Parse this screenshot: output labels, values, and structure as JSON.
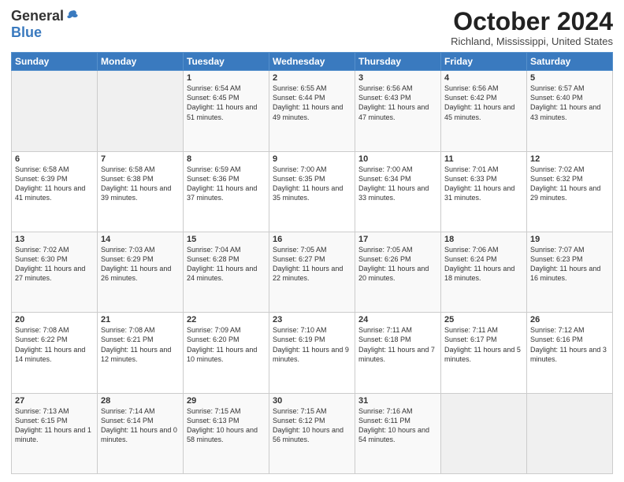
{
  "logo": {
    "general": "General",
    "blue": "Blue"
  },
  "title": "October 2024",
  "location": "Richland, Mississippi, United States",
  "days_header": [
    "Sunday",
    "Monday",
    "Tuesday",
    "Wednesday",
    "Thursday",
    "Friday",
    "Saturday"
  ],
  "weeks": [
    [
      {
        "day": "",
        "info": ""
      },
      {
        "day": "",
        "info": ""
      },
      {
        "day": "1",
        "info": "Sunrise: 6:54 AM\nSunset: 6:45 PM\nDaylight: 11 hours and 51 minutes."
      },
      {
        "day": "2",
        "info": "Sunrise: 6:55 AM\nSunset: 6:44 PM\nDaylight: 11 hours and 49 minutes."
      },
      {
        "day": "3",
        "info": "Sunrise: 6:56 AM\nSunset: 6:43 PM\nDaylight: 11 hours and 47 minutes."
      },
      {
        "day": "4",
        "info": "Sunrise: 6:56 AM\nSunset: 6:42 PM\nDaylight: 11 hours and 45 minutes."
      },
      {
        "day": "5",
        "info": "Sunrise: 6:57 AM\nSunset: 6:40 PM\nDaylight: 11 hours and 43 minutes."
      }
    ],
    [
      {
        "day": "6",
        "info": "Sunrise: 6:58 AM\nSunset: 6:39 PM\nDaylight: 11 hours and 41 minutes."
      },
      {
        "day": "7",
        "info": "Sunrise: 6:58 AM\nSunset: 6:38 PM\nDaylight: 11 hours and 39 minutes."
      },
      {
        "day": "8",
        "info": "Sunrise: 6:59 AM\nSunset: 6:36 PM\nDaylight: 11 hours and 37 minutes."
      },
      {
        "day": "9",
        "info": "Sunrise: 7:00 AM\nSunset: 6:35 PM\nDaylight: 11 hours and 35 minutes."
      },
      {
        "day": "10",
        "info": "Sunrise: 7:00 AM\nSunset: 6:34 PM\nDaylight: 11 hours and 33 minutes."
      },
      {
        "day": "11",
        "info": "Sunrise: 7:01 AM\nSunset: 6:33 PM\nDaylight: 11 hours and 31 minutes."
      },
      {
        "day": "12",
        "info": "Sunrise: 7:02 AM\nSunset: 6:32 PM\nDaylight: 11 hours and 29 minutes."
      }
    ],
    [
      {
        "day": "13",
        "info": "Sunrise: 7:02 AM\nSunset: 6:30 PM\nDaylight: 11 hours and 27 minutes."
      },
      {
        "day": "14",
        "info": "Sunrise: 7:03 AM\nSunset: 6:29 PM\nDaylight: 11 hours and 26 minutes."
      },
      {
        "day": "15",
        "info": "Sunrise: 7:04 AM\nSunset: 6:28 PM\nDaylight: 11 hours and 24 minutes."
      },
      {
        "day": "16",
        "info": "Sunrise: 7:05 AM\nSunset: 6:27 PM\nDaylight: 11 hours and 22 minutes."
      },
      {
        "day": "17",
        "info": "Sunrise: 7:05 AM\nSunset: 6:26 PM\nDaylight: 11 hours and 20 minutes."
      },
      {
        "day": "18",
        "info": "Sunrise: 7:06 AM\nSunset: 6:24 PM\nDaylight: 11 hours and 18 minutes."
      },
      {
        "day": "19",
        "info": "Sunrise: 7:07 AM\nSunset: 6:23 PM\nDaylight: 11 hours and 16 minutes."
      }
    ],
    [
      {
        "day": "20",
        "info": "Sunrise: 7:08 AM\nSunset: 6:22 PM\nDaylight: 11 hours and 14 minutes."
      },
      {
        "day": "21",
        "info": "Sunrise: 7:08 AM\nSunset: 6:21 PM\nDaylight: 11 hours and 12 minutes."
      },
      {
        "day": "22",
        "info": "Sunrise: 7:09 AM\nSunset: 6:20 PM\nDaylight: 11 hours and 10 minutes."
      },
      {
        "day": "23",
        "info": "Sunrise: 7:10 AM\nSunset: 6:19 PM\nDaylight: 11 hours and 9 minutes."
      },
      {
        "day": "24",
        "info": "Sunrise: 7:11 AM\nSunset: 6:18 PM\nDaylight: 11 hours and 7 minutes."
      },
      {
        "day": "25",
        "info": "Sunrise: 7:11 AM\nSunset: 6:17 PM\nDaylight: 11 hours and 5 minutes."
      },
      {
        "day": "26",
        "info": "Sunrise: 7:12 AM\nSunset: 6:16 PM\nDaylight: 11 hours and 3 minutes."
      }
    ],
    [
      {
        "day": "27",
        "info": "Sunrise: 7:13 AM\nSunset: 6:15 PM\nDaylight: 11 hours and 1 minute."
      },
      {
        "day": "28",
        "info": "Sunrise: 7:14 AM\nSunset: 6:14 PM\nDaylight: 11 hours and 0 minutes."
      },
      {
        "day": "29",
        "info": "Sunrise: 7:15 AM\nSunset: 6:13 PM\nDaylight: 10 hours and 58 minutes."
      },
      {
        "day": "30",
        "info": "Sunrise: 7:15 AM\nSunset: 6:12 PM\nDaylight: 10 hours and 56 minutes."
      },
      {
        "day": "31",
        "info": "Sunrise: 7:16 AM\nSunset: 6:11 PM\nDaylight: 10 hours and 54 minutes."
      },
      {
        "day": "",
        "info": ""
      },
      {
        "day": "",
        "info": ""
      }
    ]
  ]
}
